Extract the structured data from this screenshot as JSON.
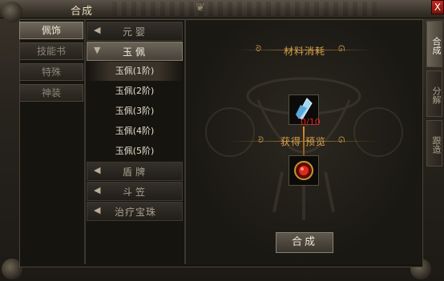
{
  "window": {
    "title": "合成",
    "close": "X"
  },
  "categories": [
    {
      "label": "佩饰",
      "active": true
    },
    {
      "label": "技能书",
      "active": false
    },
    {
      "label": "特殊",
      "active": false
    },
    {
      "label": "神装",
      "active": false
    }
  ],
  "list": {
    "yuanying": "元婴",
    "yupei": "玉佩",
    "sub_items": [
      "玉佩(1阶)",
      "玉佩(2阶)",
      "玉佩(3阶)",
      "玉佩(4阶)",
      "玉佩(5阶)"
    ],
    "dunpai": "盾牌",
    "douli": "斗笠",
    "zhiliao": "治疗宝珠"
  },
  "panel": {
    "materials_heading": "材料消耗",
    "material_count": "0/10",
    "preview_heading": "获得 预览",
    "craft_button": "合成"
  },
  "side_tabs": [
    {
      "label": "合成",
      "active": true
    },
    {
      "label": "分解",
      "active": false
    },
    {
      "label": "跟造",
      "active": false
    }
  ],
  "icons": {
    "material": "blue-crystal-icon",
    "result": "red-gem-pendant-icon",
    "arrow_right": "triangle-right-icon",
    "arrow_left": "triangle-left-icon",
    "arrow_down": "triangle-down-icon"
  },
  "colors": {
    "accent_gold": "#d8a24a",
    "count_red": "#e2231a",
    "close_red": "#c42a1e"
  }
}
